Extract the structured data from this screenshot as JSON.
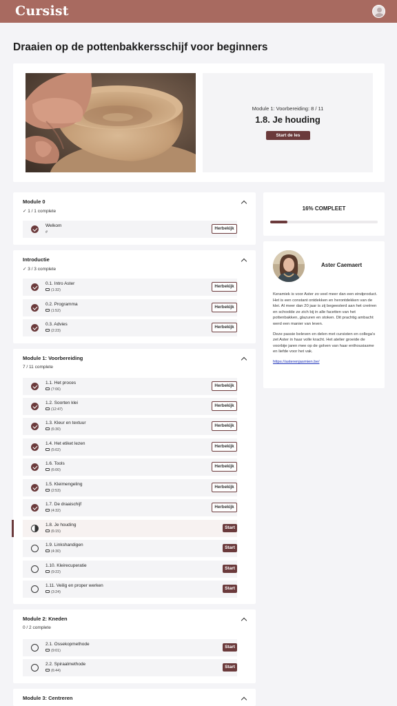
{
  "header": {
    "logo": "Cursist",
    "accent": "#a86a60",
    "button_color": "#6b3a3b",
    "avatar_icon": "user-avatar-icon"
  },
  "course": {
    "title": "Draaien op de pottenbakkersschijf voor beginners",
    "current": {
      "module_progress": "Module 1: Voorbereiding: 8 / 11",
      "lesson": "1.8. Je houding",
      "cta": "Start de les"
    }
  },
  "progress": {
    "label": "16% COMPLEET",
    "fraction": 0.16
  },
  "author": {
    "name": "Aster Caemaert",
    "bio": [
      "Keramiek is voor Aster zo veel meer dan een eindproduct. Het is een constant ontdekken en herontdekken van de klei. Al meer dan 20 jaar is zij begeesterd aan het creëren en schoolde ze zich bij in alle facetten van het pottenbakken, glazuren en stoken. Dit prachtig ambacht werd een manier van leven.",
      "Deze passie beleven en delen met cursisten en collega's zet Aster in haar volle kracht. Het atelier groeide de voorbije jaren mee op de golven van haar enthousiasme en liefde voor het vak."
    ],
    "link": "https://asterenjasmien.be/"
  },
  "modules": [
    {
      "title": "Module 0",
      "count": "1 / 1 complete",
      "complete": true,
      "lessons": [
        {
          "title": "Welkom",
          "duration": "",
          "status": "done",
          "action": "Herbekijk"
        }
      ]
    },
    {
      "title": "Introductie",
      "count": "3 / 3 complete",
      "complete": true,
      "lessons": [
        {
          "title": "0.1. Intro Aster",
          "duration": "(1:32)",
          "status": "done",
          "action": "Herbekijk"
        },
        {
          "title": "0.2. Programma",
          "duration": "(1:52)",
          "status": "done",
          "action": "Herbekijk"
        },
        {
          "title": "0.3. Advies",
          "duration": "(2:23)",
          "status": "done",
          "action": "Herbekijk"
        }
      ]
    },
    {
      "title": "Module 1: Voorbereiding",
      "count": "7 / 11 complete",
      "complete": false,
      "lessons": [
        {
          "title": "1.1. Het proces",
          "duration": "(7:06)",
          "status": "done",
          "action": "Herbekijk"
        },
        {
          "title": "1.2. Soorten klei",
          "duration": "(12:47)",
          "status": "done",
          "action": "Herbekijk"
        },
        {
          "title": "1.3. Kleur en textuur",
          "duration": "(6:30)",
          "status": "done",
          "action": "Herbekijk"
        },
        {
          "title": "1.4. Het etiket lezen",
          "duration": "(5:02)",
          "status": "done",
          "action": "Herbekijk"
        },
        {
          "title": "1.6. Tools",
          "duration": "(6:00)",
          "status": "done",
          "action": "Herbekijk"
        },
        {
          "title": "1.5. Kleimengeling",
          "duration": "(2:53)",
          "status": "done",
          "action": "Herbekijk"
        },
        {
          "title": "1.7. De draaischijf",
          "duration": "(4:32)",
          "status": "done",
          "action": "Herbekijk"
        },
        {
          "title": "1.8. Je houding",
          "duration": "(6:15)",
          "status": "current",
          "action": "Start"
        },
        {
          "title": "1.9. Linkshandigen",
          "duration": "(4:30)",
          "status": "todo",
          "action": "Start"
        },
        {
          "title": "1.10. Kleirecuperatie",
          "duration": "(9:22)",
          "status": "todo",
          "action": "Start"
        },
        {
          "title": "1.11. Veilig en proper werken",
          "duration": "(3:24)",
          "status": "todo",
          "action": "Start"
        }
      ]
    },
    {
      "title": "Module 2: Kneden",
      "count": "0 / 2 complete",
      "complete": false,
      "lessons": [
        {
          "title": "2.1. Ossekopmethode",
          "duration": "(9:01)",
          "status": "todo",
          "action": "Start"
        },
        {
          "title": "2.2. Spiraalmethode",
          "duration": "(6:44)",
          "status": "todo",
          "action": "Start"
        }
      ]
    },
    {
      "title": "Module 3: Centreren",
      "count": "",
      "complete": false,
      "lessons": []
    }
  ]
}
